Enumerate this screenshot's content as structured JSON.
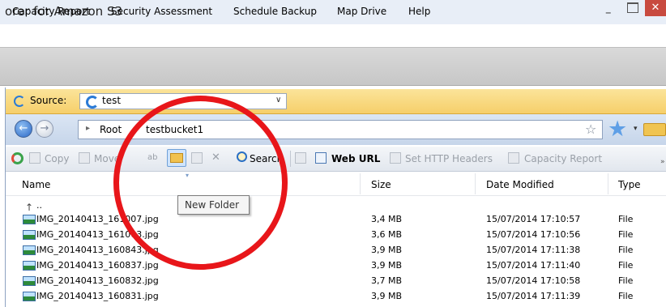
{
  "window": {
    "title": "orer for Amazon S3",
    "minimize_glyph": "–",
    "close_glyph": "✕"
  },
  "menu": {
    "items": [
      {
        "label": "Capacity Report"
      },
      {
        "label": "Security Assessment"
      },
      {
        "label": "Schedule Backup"
      },
      {
        "label": "Map Drive"
      },
      {
        "label": "Help"
      }
    ]
  },
  "source": {
    "label": "Source:",
    "value": "test",
    "caret": "∨"
  },
  "address": {
    "separator": "▸",
    "root": "Root",
    "bucket": "testbucket1",
    "star_glyph": "☆",
    "fav_glyph": "★",
    "fav_caret": "▾"
  },
  "toolbar": {
    "copy": "Copy",
    "move": "Move",
    "rename_fragment": "ab",
    "search": "Search",
    "web_url": "Web URL",
    "set_http_headers": "Set HTTP Headers",
    "capacity_report": "Capacity Report",
    "delete_glyph": "✕",
    "overflow": "»"
  },
  "tooltip": {
    "text": "New Folder"
  },
  "table": {
    "columns": [
      "Name",
      "Size",
      "Date Modified",
      "Type"
    ],
    "sort_glyph": "▾",
    "up_row": {
      "icon_glyph": "↑",
      "name": ".."
    },
    "rows": [
      {
        "name": "IMG_20140413_161007.jpg",
        "size": "3,4 MB",
        "date": "15/07/2014 17:10:57",
        "type": "File"
      },
      {
        "name": "IMG_20140413_161003.jpg",
        "size": "3,6 MB",
        "date": "15/07/2014 17:10:56",
        "type": "File"
      },
      {
        "name": "IMG_20140413_160843.jpg",
        "size": "3,9 MB",
        "date": "15/07/2014 17:11:38",
        "type": "File"
      },
      {
        "name": "IMG_20140413_160837.jpg",
        "size": "3,9 MB",
        "date": "15/07/2014 17:11:40",
        "type": "File"
      },
      {
        "name": "IMG_20140413_160832.jpg",
        "size": "3,7 MB",
        "date": "15/07/2014 17:10:58",
        "type": "File"
      },
      {
        "name": "IMG_20140413_160831.jpg",
        "size": "3,9 MB",
        "date": "15/07/2014 17:11:39",
        "type": "File"
      }
    ]
  },
  "colors": {
    "annotation": "#e8161a",
    "source_bar": "#f6cf6a",
    "address_bar": "#c6d5ea"
  }
}
